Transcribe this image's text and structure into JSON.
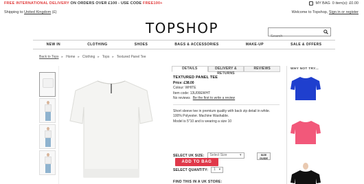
{
  "promo": {
    "free_delivery": "FREE INTERNATIONAL DELIVERY",
    "offer": "ON ORDERS OVER £100 - USE CODE",
    "code": "FREE100",
    "plus": "+",
    "my_bag": "MY BAG",
    "bag_count": "0 item(s): £0.00"
  },
  "subbar": {
    "shipping_prefix": "Shipping to",
    "country_link": "United Kingdom",
    "currency": "(£)",
    "welcome": "Welcome to Topshop,",
    "signin": "Sign in or register"
  },
  "logo": "TOPSHOP",
  "search": {
    "placeholder": "Search"
  },
  "nav": [
    "NEW IN",
    "CLOTHING",
    "SHOES",
    "BAGS & ACCESSORIES",
    "MAKE-UP",
    "SALE & OFFERS"
  ],
  "breadcrumb": {
    "back": "Back to Tops",
    "items": [
      "Home",
      "Clothing",
      "Tops",
      "Textured Panel Tee"
    ]
  },
  "tabs": [
    "DETAILS",
    "DELIVERY & RETURNS",
    "REVIEWS"
  ],
  "product": {
    "title": "TEXTURED PANEL TEE",
    "price": "Price: £38.00",
    "colour": "Colour: WHITE",
    "item_code": "Item code: 13U09EWHT",
    "no_reviews": "No reviews",
    "write_review": "Be the first to write a review",
    "description": "Short sleeve tee in premium quality with back zip detail in white. 100% Polyester. Machine Washable.",
    "model_info": "Model is 5\"10 and is wearing a size 10"
  },
  "size": {
    "label": "SELECT UK SIZE:",
    "value": "Select Size",
    "guide": "SIZE GUIDE"
  },
  "quantity": {
    "label": "SELECT QUANTITY:",
    "value": "1"
  },
  "add_to_bag": "ADD TO BAG",
  "find_store": "FIND THIS IN A UK STORE:",
  "why_not_try": "WHY NOT TRY...",
  "colors": {
    "promo_red": "#e03b3b",
    "button_red": "#e0394a",
    "wnt_blue": "#1f3fce",
    "wnt_pink": "#f2587a"
  }
}
